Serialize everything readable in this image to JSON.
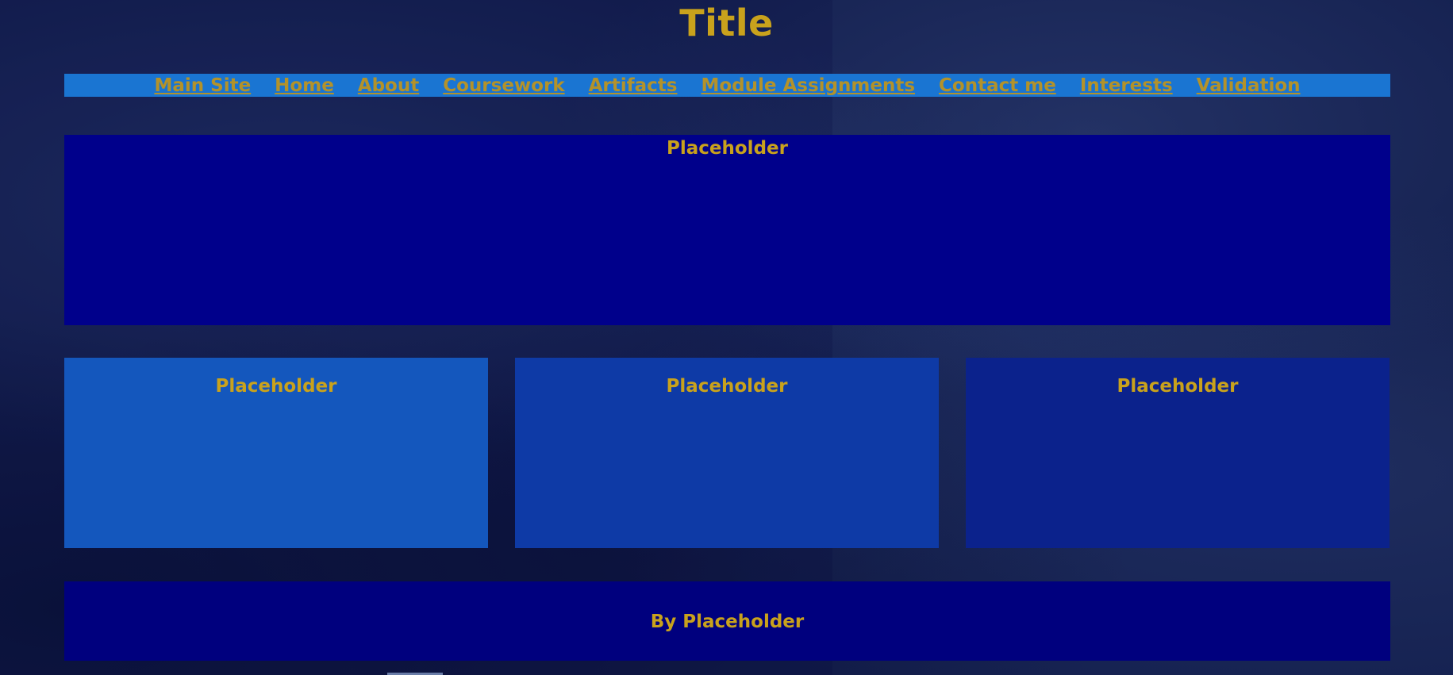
{
  "page": {
    "title": "Title"
  },
  "nav": {
    "items": [
      {
        "label": "Main Site"
      },
      {
        "label": "Home"
      },
      {
        "label": "About"
      },
      {
        "label": "Coursework"
      },
      {
        "label": "Artifacts"
      },
      {
        "label": "Module Assignments"
      },
      {
        "label": "Contact me"
      },
      {
        "label": "Interests"
      },
      {
        "label": "Validation"
      }
    ]
  },
  "hero": {
    "heading": "Placeholder"
  },
  "cards": [
    {
      "heading": "Placeholder"
    },
    {
      "heading": "Placeholder"
    },
    {
      "heading": "Placeholder"
    }
  ],
  "footer": {
    "text": "By Placeholder"
  },
  "colors": {
    "text_gold": "#c9a21c",
    "nav_background": "#1a75d2",
    "hero_background": "#00008b",
    "card_1_background": "#1457bd",
    "card_2_background": "#0e3aa6",
    "card_3_background": "#0b228c",
    "footer_background": "#00007e",
    "page_background": "#14204f"
  }
}
